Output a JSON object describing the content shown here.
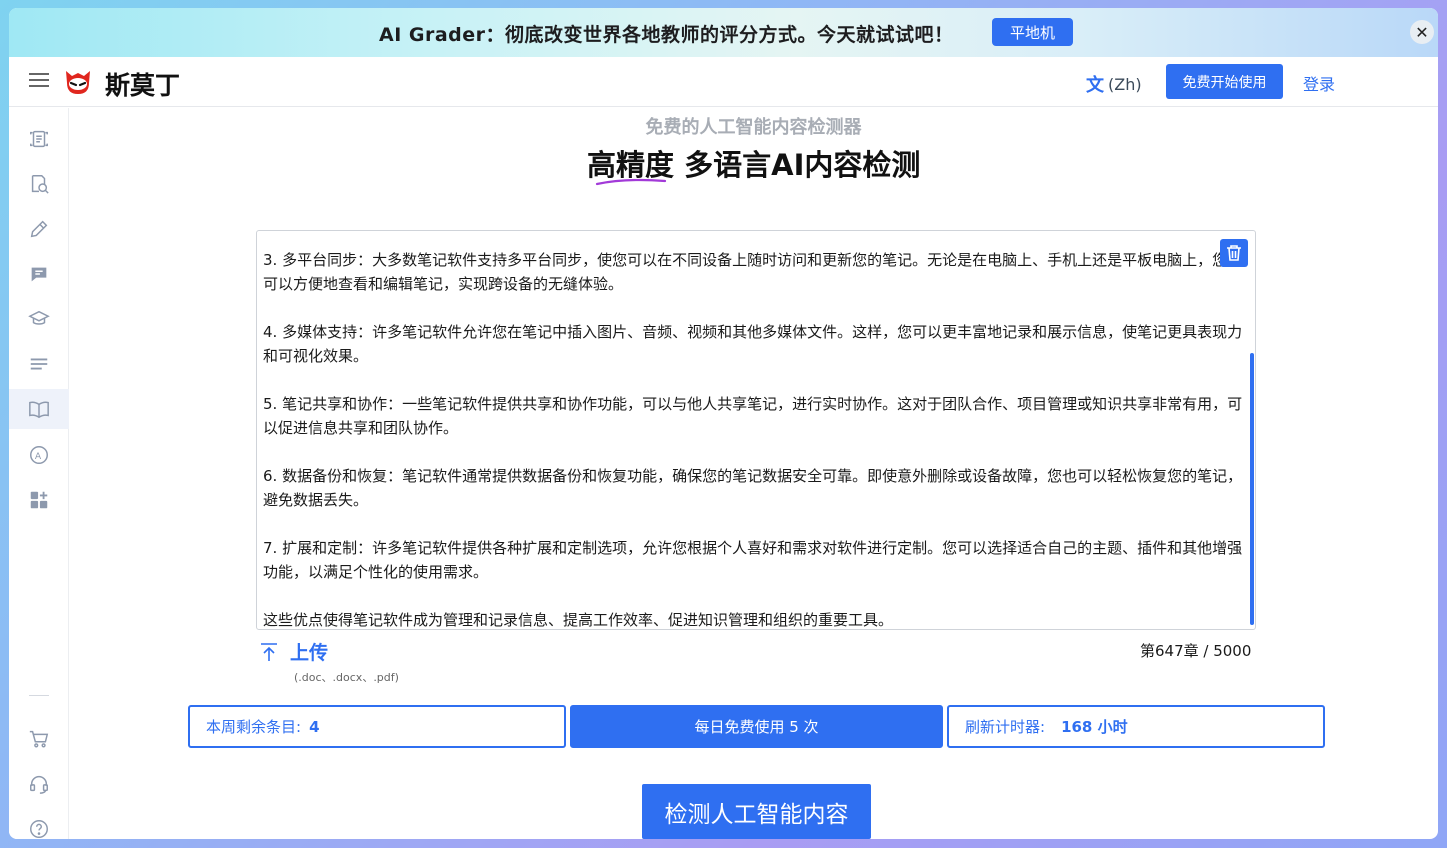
{
  "banner": {
    "text": "AI Grader：彻底改变世界各地教师的评分方式。今天就试试吧！",
    "button_label": "平地机",
    "close_glyph": "✕"
  },
  "header": {
    "brand": "斯莫丁",
    "language": "(Zh)",
    "language_icon": "translate-icon",
    "start_button": "免费开始使用",
    "login": "登录"
  },
  "sidebar": {
    "items": [
      {
        "icon": "document-scan-icon"
      },
      {
        "icon": "research-icon"
      },
      {
        "icon": "pencil-icon"
      },
      {
        "icon": "chat-icon"
      },
      {
        "icon": "graduation-cap-icon"
      },
      {
        "icon": "text-lines-icon"
      },
      {
        "icon": "open-book-icon",
        "active": true
      },
      {
        "icon": "ai-circle-icon"
      },
      {
        "icon": "apps-grid-icon"
      },
      {
        "icon": "cart-icon"
      },
      {
        "icon": "headset-icon"
      },
      {
        "icon": "help-icon"
      }
    ]
  },
  "main": {
    "subtitle": "免费的人工智能内容检测器",
    "title_part1": "高精度",
    "title_part2": "多语言AI内容检测",
    "editor_paragraphs": [
      "3. 多平台同步：大多数笔记软件支持多平台同步，使您可以在不同设备上随时访问和更新您的笔记。无论是在电脑上、手机上还是平板电脑上，您都可以方便地查看和编辑笔记，实现跨设备的无缝体验。",
      "4. 多媒体支持：许多笔记软件允许您在笔记中插入图片、音频、视频和其他多媒体文件。这样，您可以更丰富地记录和展示信息，使笔记更具表现力和可视化效果。",
      "5. 笔记共享和协作：一些笔记软件提供共享和协作功能，可以与他人共享笔记，进行实时协作。这对于团队合作、项目管理或知识共享非常有用，可以促进信息共享和团队协作。",
      "6. 数据备份和恢复：笔记软件通常提供数据备份和恢复功能，确保您的笔记数据安全可靠。即使意外删除或设备故障，您也可以轻松恢复您的笔记，避免数据丢失。",
      "7. 扩展和定制：许多笔记软件提供各种扩展和定制选项，允许您根据个人喜好和需求对软件进行定制。您可以选择适合自己的主题、插件和其他增强功能，以满足个性化的使用需求。",
      "这些优点使得笔记软件成为管理和记录信息、提高工作效率、促进知识管理和组织的重要工具。"
    ],
    "upload_label": "上传",
    "upload_formats": "(.doc、.docx、.pdf)",
    "counter": "第647章 / 5000",
    "remaining_label": "本周剩余条目:",
    "remaining_value": "4",
    "daily_free": "每日免费使用 5 次",
    "refresh_label": "刷新计时器:",
    "refresh_value": "168 小时",
    "detect_button": "检测人工智能内容"
  },
  "colors": {
    "accent": "#2f6ff1",
    "title_underline": "#a23ad8"
  }
}
